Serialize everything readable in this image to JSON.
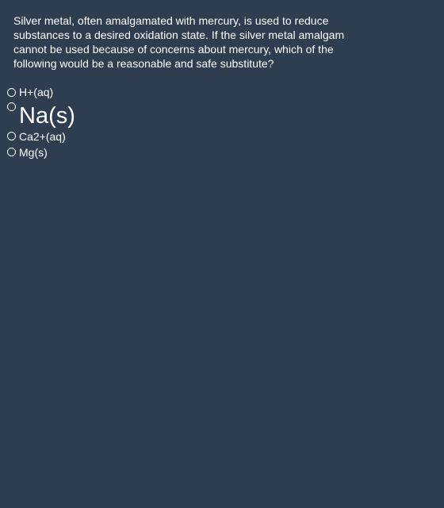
{
  "question": {
    "text": "Silver metal, often amalgamated with mercury, is used to reduce substances to a desired oxidation state. If the silver metal amalgam cannot be used because of concerns about mercury, which of the following would be a reasonable and safe substitute?"
  },
  "options": [
    {
      "label": "H+(aq)"
    },
    {
      "label": "Na(s)"
    },
    {
      "label": "Ca2+(aq)"
    },
    {
      "label": "Mg(s)"
    }
  ],
  "colors": {
    "background": "#2e3d4f",
    "text": "#ffffff"
  }
}
